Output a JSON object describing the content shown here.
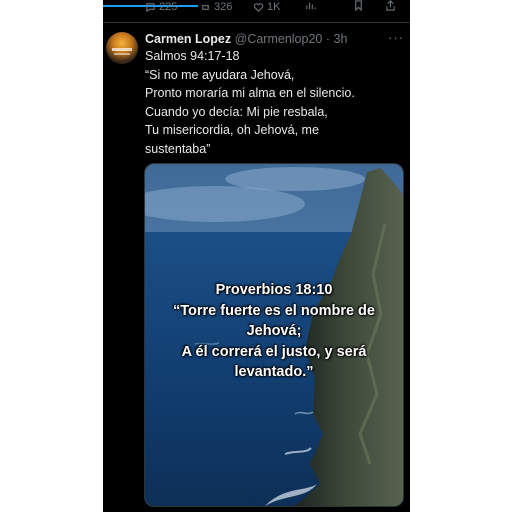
{
  "prev_tweet": {
    "actions": [
      {
        "icon": "comment-icon",
        "count": "225"
      },
      {
        "icon": "retweet-icon",
        "count": "326"
      },
      {
        "icon": "heart-icon",
        "count": "1K"
      },
      {
        "icon": "views-icon",
        "count": ""
      },
      {
        "icon": "bookmark-icon",
        "count": ""
      },
      {
        "icon": "share-icon",
        "count": ""
      }
    ]
  },
  "tweet": {
    "author_name": "Carmen Lopez",
    "handle": "@Carmenlop20",
    "separator": "·",
    "time": "3h",
    "more_label": "···",
    "text_lines": [
      "Salmos 94:17-18",
      "“Si no me ayudara Jehová,",
      "Pronto moraría mi alma en el silencio.",
      "Cuando yo decía: Mi pie resbala,",
      "Tu misericordia, oh Jehová, me",
      "sustentaba”"
    ],
    "image_caption": [
      "Proverbios 18:10",
      "“Torre fuerte es el nombre de",
      "Jehová;",
      "A él correrá el justo, y será",
      "levantado.”"
    ]
  },
  "colors": {
    "background": "#000000",
    "text": "#e7e9ea",
    "muted": "#71767b",
    "accent": "#1d9bf0"
  }
}
